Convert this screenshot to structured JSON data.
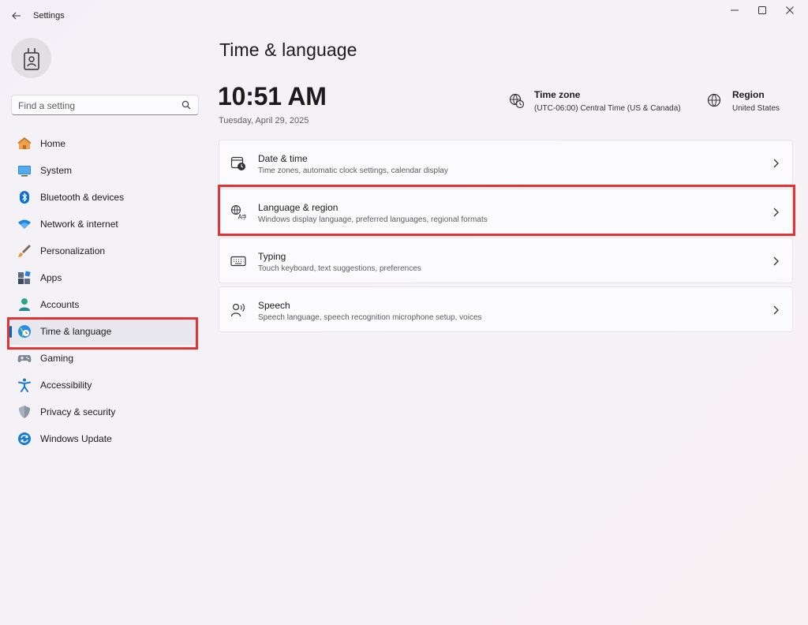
{
  "window": {
    "title": "Settings"
  },
  "search": {
    "placeholder": "Find a setting"
  },
  "sidebar": {
    "items": [
      {
        "label": "Home"
      },
      {
        "label": "System"
      },
      {
        "label": "Bluetooth & devices"
      },
      {
        "label": "Network & internet"
      },
      {
        "label": "Personalization"
      },
      {
        "label": "Apps"
      },
      {
        "label": "Accounts"
      },
      {
        "label": "Time & language"
      },
      {
        "label": "Gaming"
      },
      {
        "label": "Accessibility"
      },
      {
        "label": "Privacy & security"
      },
      {
        "label": "Windows Update"
      }
    ],
    "selected": "Time & language"
  },
  "main": {
    "title": "Time & language",
    "time": "10:51 AM",
    "date": "Tuesday, April 29, 2025",
    "timezone": {
      "title": "Time zone",
      "value": "(UTC-06:00) Central Time (US & Canada)"
    },
    "region": {
      "title": "Region",
      "value": "United States"
    },
    "cards": [
      {
        "title": "Date & time",
        "subtitle": "Time zones, automatic clock settings, calendar display",
        "icon": "calendar-clock-icon"
      },
      {
        "title": "Language & region",
        "subtitle": "Windows display language, preferred languages, regional formats",
        "icon": "language-icon"
      },
      {
        "title": "Typing",
        "subtitle": "Touch keyboard, text suggestions, preferences",
        "icon": "keyboard-icon"
      },
      {
        "title": "Speech",
        "subtitle": "Speech language, speech recognition microphone setup, voices",
        "icon": "speech-icon"
      }
    ]
  },
  "colors": {
    "accent": "#0067c0",
    "highlight_box": "#e23434"
  }
}
